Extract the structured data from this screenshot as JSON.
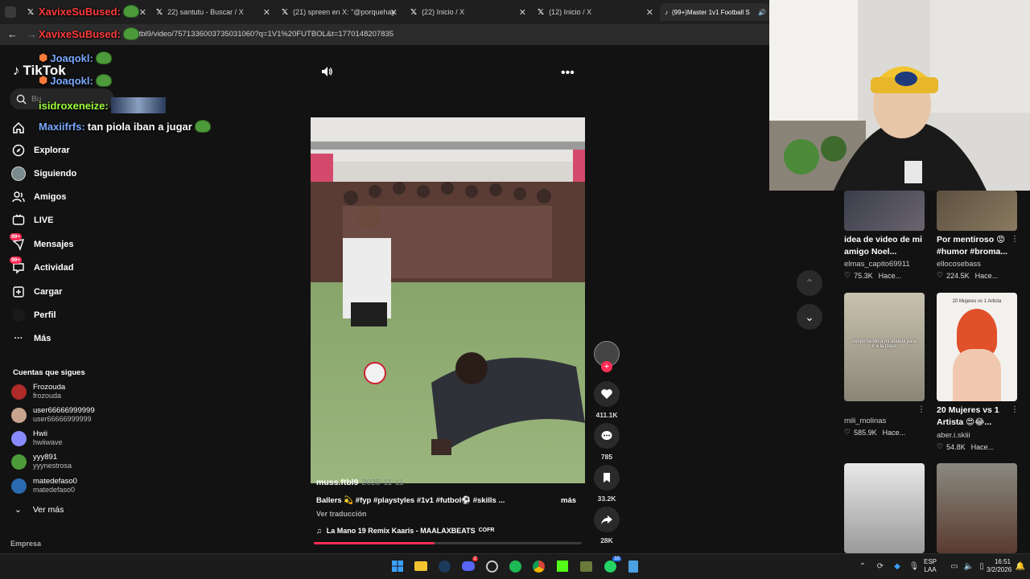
{
  "browser": {
    "tabs": [
      {
        "label": "22) santutu - Buscar / X"
      },
      {
        "label": "(21) spreen en X: \"@porquehay"
      },
      {
        "label": "(22) Inicio / X"
      },
      {
        "label": "(12) Inicio / X"
      },
      {
        "label": "(99+)Master 1v1 Football S"
      }
    ],
    "url": "ftbl9/video/7571336003735031060?q=1V1%20FUTBOL&t=1770148207835"
  },
  "sidebar": {
    "logo": "TikTok",
    "search_placeholder": "Bu",
    "items": [
      {
        "label": "Explorar"
      },
      {
        "label": "Siguiendo"
      },
      {
        "label": "Amigos"
      },
      {
        "label": "LIVE"
      },
      {
        "label": "Mensajes",
        "badge": "99+"
      },
      {
        "label": "Actividad",
        "badge": "99+"
      },
      {
        "label": "Cargar"
      },
      {
        "label": "Perfil"
      },
      {
        "label": "Más"
      }
    ],
    "follows_title": "Cuentas que sigues",
    "accounts": [
      {
        "name": "Frozouda",
        "handle": "frozouda"
      },
      {
        "name": "user66666999999",
        "handle": "user66666999999"
      },
      {
        "name": "Hwii",
        "handle": "hwiiwave"
      },
      {
        "name": "yyy891",
        "handle": "yyynestrosa"
      },
      {
        "name": "matedefaso0",
        "handle": "matedefaso0"
      }
    ],
    "see_more": "Ver más",
    "company": "Empresa"
  },
  "chat": [
    {
      "user": "XavixeSuBused:",
      "color": "#ff3b3b",
      "text": ""
    },
    {
      "user": "Joaqokl:",
      "color": "#7aa9ff",
      "text": ""
    },
    {
      "user": "Joaqokl:",
      "color": "#7aa9ff",
      "text": ""
    },
    {
      "user": "isidroxeneize:",
      "color": "#9dff3b",
      "text": ""
    },
    {
      "user": "Maxiifrfs:",
      "color": "#7aa9ff",
      "text": "tan piola iban a jugar"
    }
  ],
  "video": {
    "author": "muss.ftbl9",
    "date": "2025-11-11",
    "caption": "Ballers 💫 #fyp #playstyles #1v1 #futbol⚽ #skills ...",
    "more": "más",
    "translate": "Ver traducción",
    "music": "La Mano 19 Remix Kaaris - MAALAXBEATS",
    "music_tag": "COFR",
    "progress": 0.45,
    "likes": "411.1K",
    "comments": "785",
    "saves": "33.2K",
    "shares": "28K"
  },
  "related": [
    {
      "title": "idea de video de mi amigo Noel...",
      "author": "elmas_capito69911",
      "likes": "75.3K",
      "time": "Hace..."
    },
    {
      "title": "Por mentiroso 😡 #humor #broma...",
      "author": "ellocosebass",
      "likes": "224.5K",
      "time": "Hace..."
    },
    {
      "title": "",
      "author": "mili_molinas",
      "likes": "585.9K",
      "time": "Hace...",
      "overlay": "despertando a mi abuela para ir a la playa"
    },
    {
      "title": "20 Mujeres vs 1 Artista 😍😂...",
      "author": "aber.i.skiii",
      "likes": "54.8K",
      "time": "Hace...",
      "overlay": "20 Mujeres vs 1 Artista"
    },
    {
      "title": "",
      "author": "",
      "likes": "",
      "time": ""
    },
    {
      "title": "",
      "author": "",
      "likes": "",
      "time": ""
    }
  ],
  "taskbar": {
    "lang_top": "ESP",
    "lang_bottom": "LAA",
    "time": "16:51",
    "date": "3/2/2026",
    "discord_badge": "2",
    "whatsapp_badge": "33"
  },
  "colors": {
    "accent": "#fe2c55",
    "bg": "#121212"
  }
}
